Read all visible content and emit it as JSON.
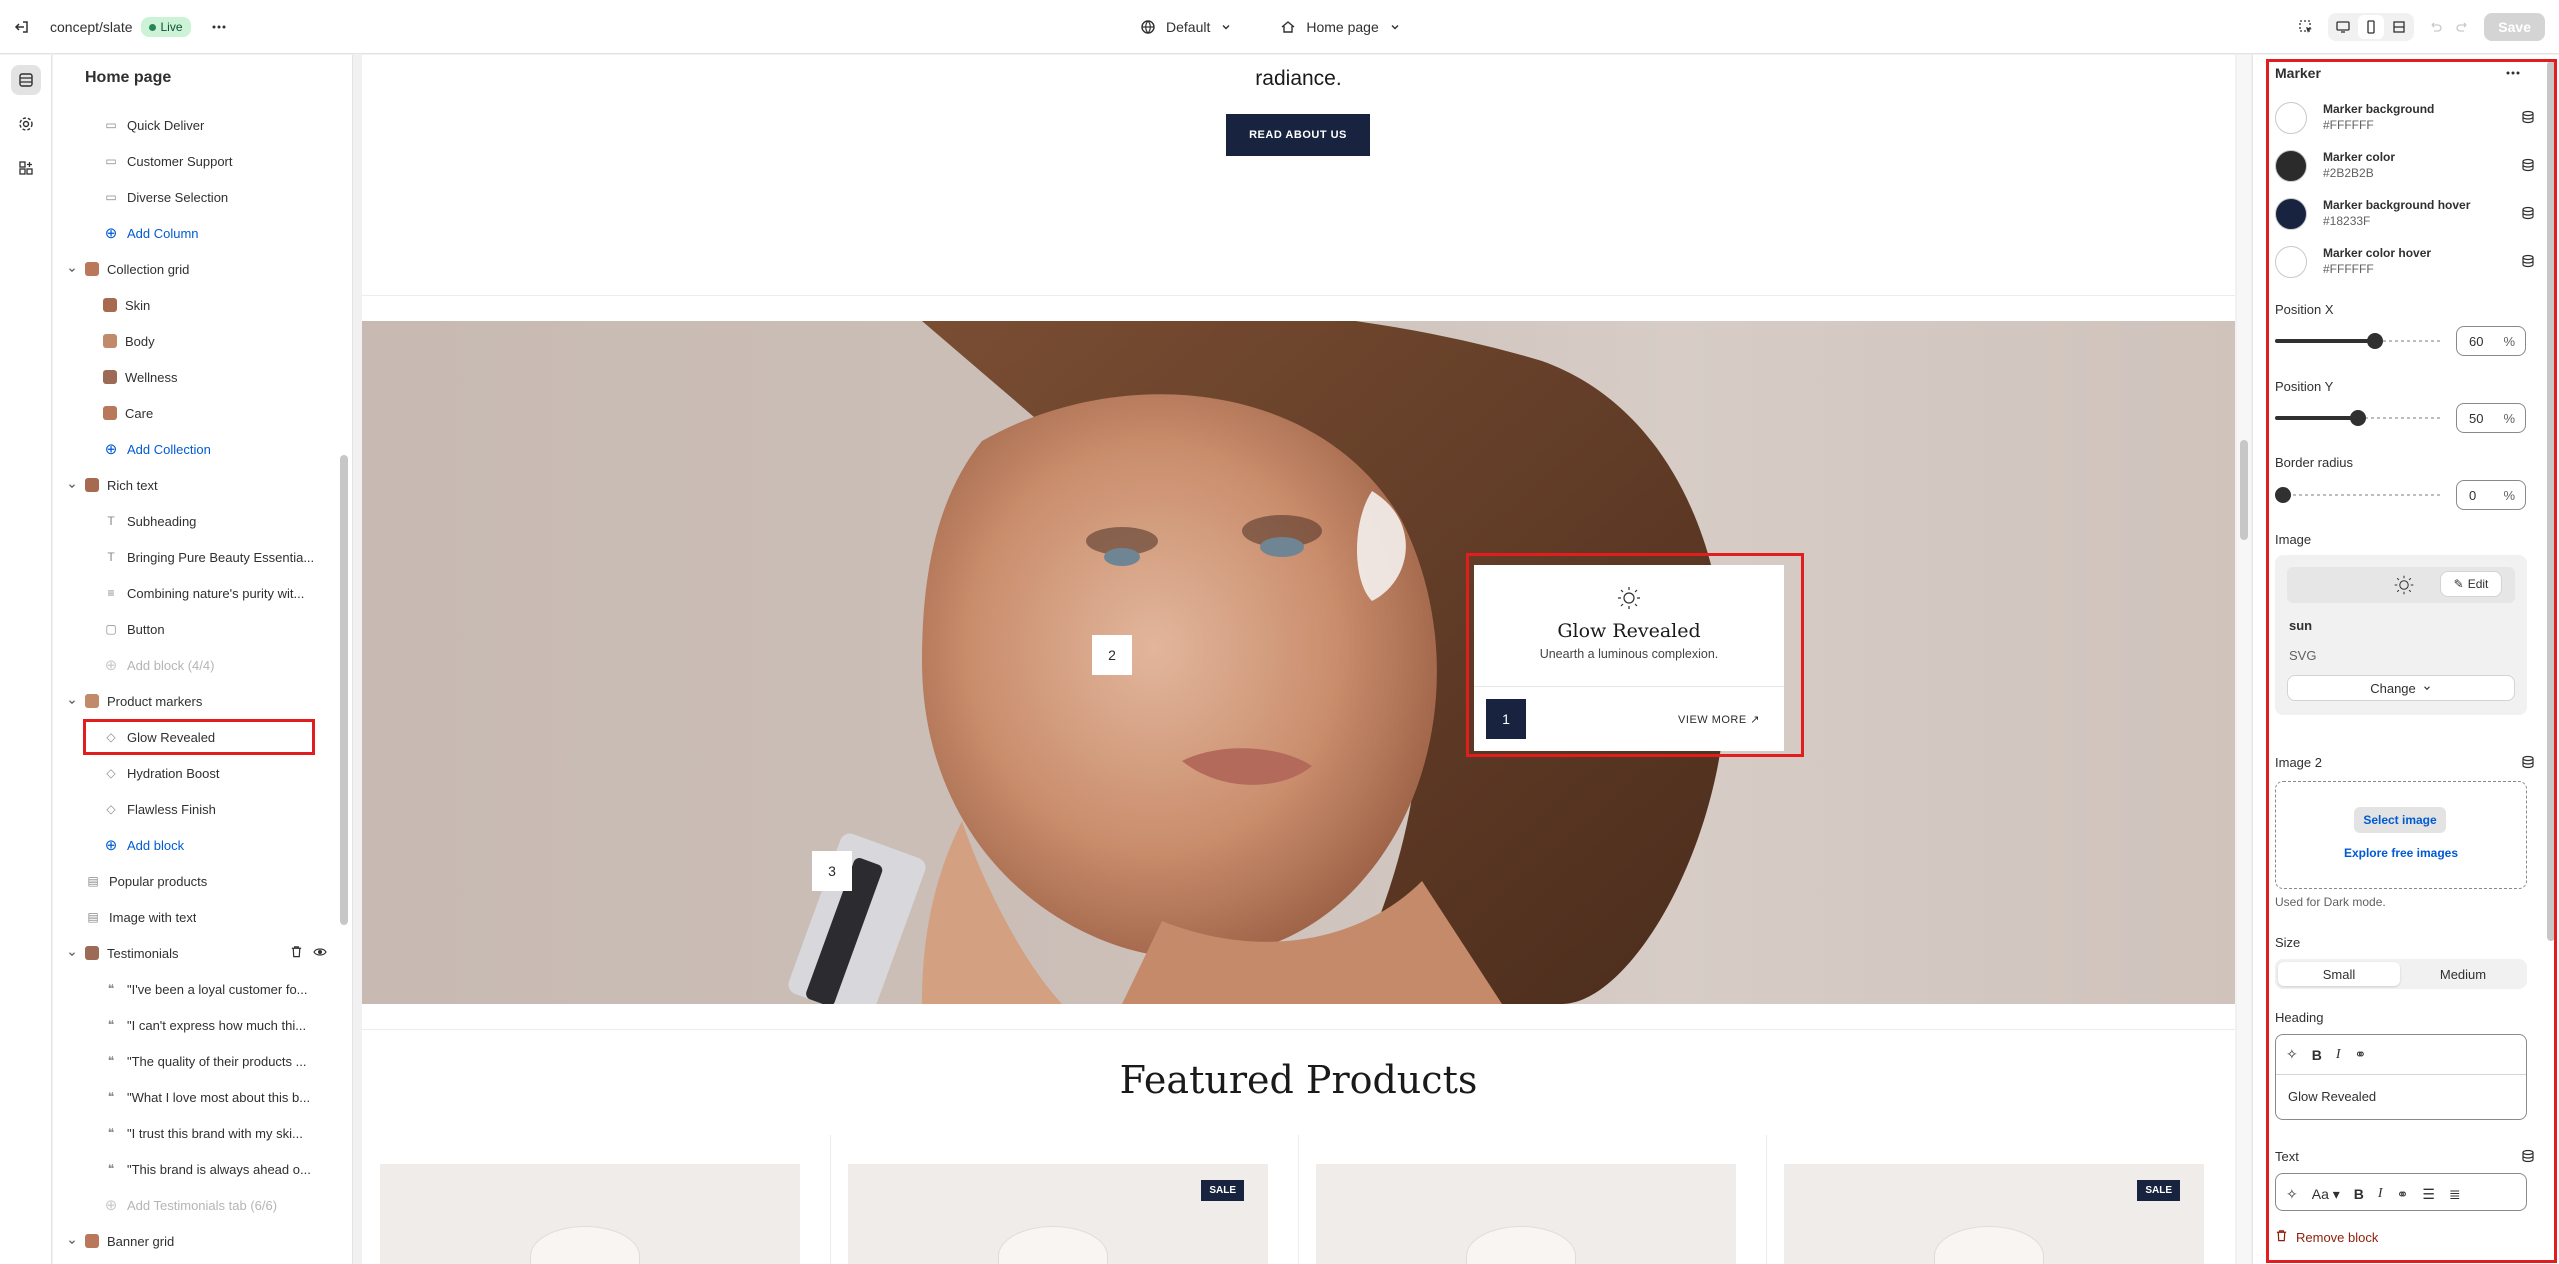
{
  "topbar": {
    "store_name": "concept/slate",
    "status": "Live",
    "theme_select": "Default",
    "page_select": "Home page",
    "save_label": "Save"
  },
  "sidebar": {
    "title": "Home page",
    "items": [
      {
        "label": "Quick Deliver",
        "level": 2,
        "icon": "column-icon"
      },
      {
        "label": "Customer Support",
        "level": 2,
        "icon": "column-icon"
      },
      {
        "label": "Diverse Selection",
        "level": 2,
        "icon": "column-icon"
      },
      {
        "label": "Add Column",
        "level": 2,
        "kind": "add"
      },
      {
        "label": "Collection grid",
        "level": 1,
        "kind": "section"
      },
      {
        "label": "Skin",
        "level": 2,
        "kind": "thumb"
      },
      {
        "label": "Body",
        "level": 2,
        "kind": "thumb"
      },
      {
        "label": "Wellness",
        "level": 2,
        "kind": "thumb"
      },
      {
        "label": "Care",
        "level": 2,
        "kind": "thumb"
      },
      {
        "label": "Add Collection",
        "level": 2,
        "kind": "add"
      },
      {
        "label": "Rich text",
        "level": 1,
        "kind": "section"
      },
      {
        "label": "Subheading",
        "level": 2,
        "icon": "text-icon"
      },
      {
        "label": "Bringing Pure Beauty Essentia...",
        "level": 2,
        "icon": "text-icon"
      },
      {
        "label": "Combining nature's purity wit...",
        "level": 2,
        "icon": "paragraph-icon"
      },
      {
        "label": "Button",
        "level": 2,
        "icon": "button-icon"
      },
      {
        "label": "Add block (4/4)",
        "level": 2,
        "kind": "disabled"
      },
      {
        "label": "Product markers",
        "level": 1,
        "kind": "section"
      },
      {
        "label": "Glow Revealed",
        "level": 2,
        "kind": "selected"
      },
      {
        "label": "Hydration Boost",
        "level": 2,
        "icon": "marker-icon"
      },
      {
        "label": "Flawless Finish",
        "level": 2,
        "icon": "marker-icon"
      },
      {
        "label": "Add block",
        "level": 2,
        "kind": "add"
      },
      {
        "label": "Popular products",
        "level": 1,
        "kind": "plain"
      },
      {
        "label": "Image with text",
        "level": 1,
        "kind": "plain"
      },
      {
        "label": "Testimonials",
        "level": 1,
        "kind": "section-hover"
      },
      {
        "label": "\"I've been a loyal customer fo...",
        "level": 2,
        "icon": "quote-icon"
      },
      {
        "label": "\"I can't express how much thi...",
        "level": 2,
        "icon": "quote-icon"
      },
      {
        "label": "\"The quality of their products ...",
        "level": 2,
        "icon": "quote-icon"
      },
      {
        "label": "\"What I love most about this b...",
        "level": 2,
        "icon": "quote-icon"
      },
      {
        "label": "\"I trust this brand with my ski...",
        "level": 2,
        "icon": "quote-icon"
      },
      {
        "label": "\"This brand is always ahead o...",
        "level": 2,
        "icon": "quote-icon"
      },
      {
        "label": "Add Testimonials tab (6/6)",
        "level": 2,
        "kind": "disabled"
      },
      {
        "label": "Banner grid",
        "level": 1,
        "kind": "section"
      }
    ]
  },
  "preview": {
    "intro_text": "radiance.",
    "read_button": "READ ABOUT US",
    "markers": [
      "1",
      "2",
      "3"
    ],
    "popup": {
      "title": "Glow Revealed",
      "text": "Unearth a luminous complexion.",
      "number": "1",
      "view_more": "VIEW MORE"
    },
    "featured_heading": "Featured Products",
    "sale_badge": "SALE"
  },
  "panel": {
    "title": "Marker",
    "colors": [
      {
        "label": "Marker background",
        "hex": "#FFFFFF"
      },
      {
        "label": "Marker color",
        "hex": "#2B2B2B"
      },
      {
        "label": "Marker background hover",
        "hex": "#18233F"
      },
      {
        "label": "Marker color hover",
        "hex": "#FFFFFF"
      }
    ],
    "position_x": {
      "label": "Position X",
      "value": "60",
      "unit": "%",
      "fraction": 0.6
    },
    "position_y": {
      "label": "Position Y",
      "value": "50",
      "unit": "%",
      "fraction": 0.5
    },
    "border_radius": {
      "label": "Border radius",
      "value": "0",
      "unit": "%",
      "fraction": 0
    },
    "image": {
      "label": "Image",
      "edit": "Edit",
      "name": "sun",
      "type": "SVG",
      "change": "Change"
    },
    "image2": {
      "label": "Image 2",
      "select": "Select image",
      "explore": "Explore free images",
      "help": "Used for Dark mode."
    },
    "size": {
      "label": "Size",
      "options": [
        "Small",
        "Medium"
      ],
      "selected": "Small"
    },
    "heading": {
      "label": "Heading",
      "value": "Glow Revealed"
    },
    "text": {
      "label": "Text"
    },
    "remove": "Remove block"
  },
  "colors": {
    "accent": "#18233F",
    "selection_outline": "#E11D1D",
    "link": "#005BD3"
  }
}
